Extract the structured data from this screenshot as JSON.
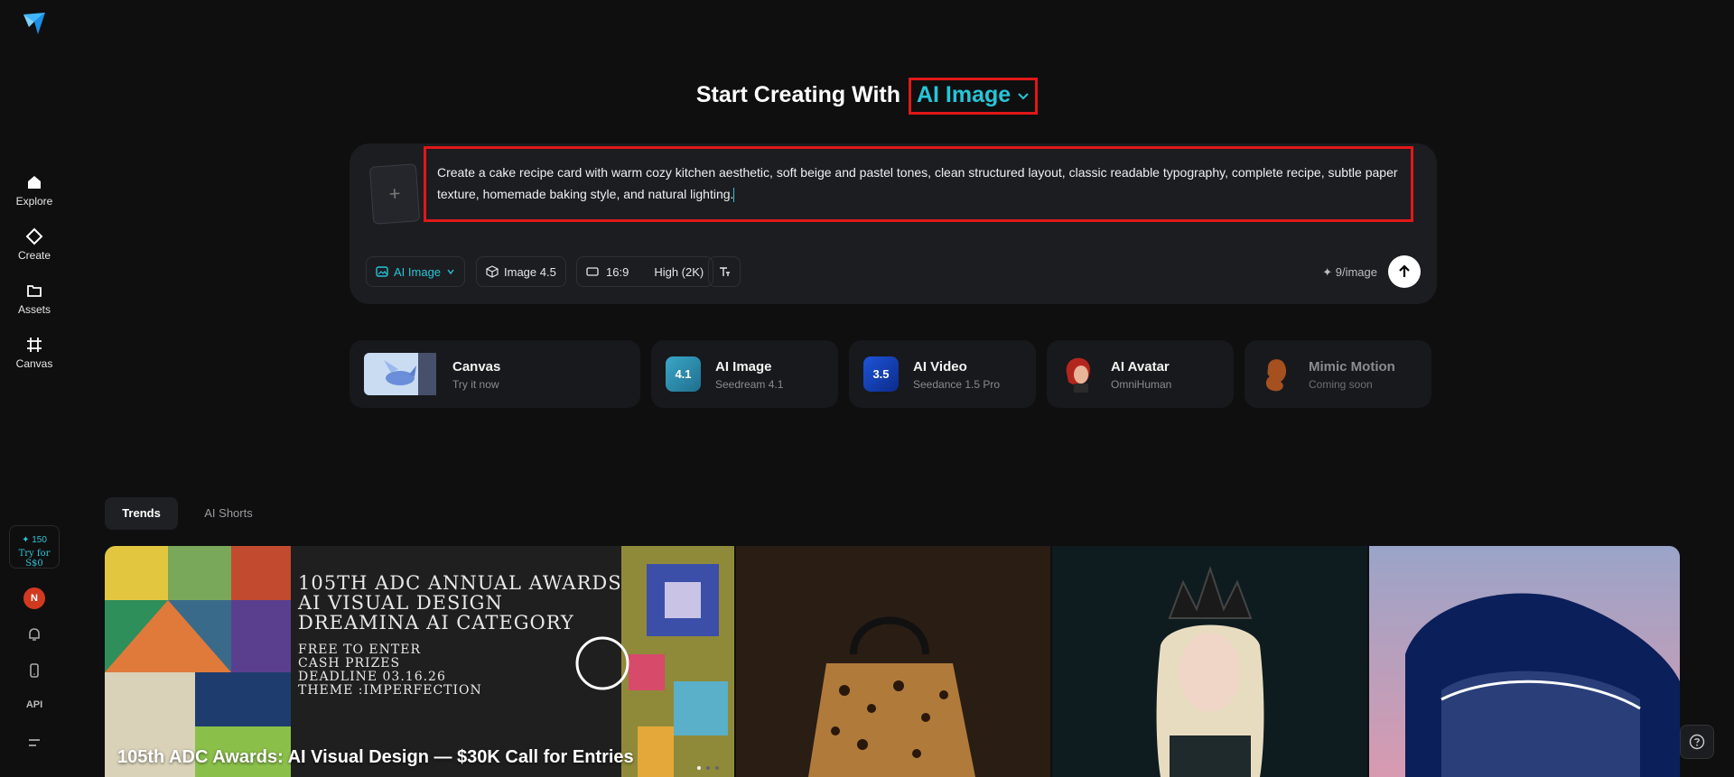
{
  "sidebar": {
    "items": [
      {
        "label": "Explore",
        "icon": "home-icon"
      },
      {
        "label": "Create",
        "icon": "diamond-icon"
      },
      {
        "label": "Assets",
        "icon": "folder-icon"
      },
      {
        "label": "Canvas",
        "icon": "canvas-icon"
      }
    ],
    "credits_amount": "150",
    "credits_promo": "Try for S$0",
    "avatar_initial": "N",
    "api_label": "API"
  },
  "header": {
    "prefix": "Start Creating With",
    "mode": "AI Image"
  },
  "prompt": {
    "text": "Create a cake recipe card with warm cozy kitchen aesthetic, soft beige and pastel tones, clean structured layout, classic readable typography, complete recipe, subtle paper texture, homemade baking style, and natural lighting.",
    "add_symbol": "+"
  },
  "toolbar": {
    "type_label": "AI Image",
    "model_label": "Image 4.5",
    "ratio_label": "16:9",
    "quality_label": "High (2K)",
    "cost_label": "9/image"
  },
  "features": [
    {
      "title": "Canvas",
      "subtitle": "Try it now"
    },
    {
      "title": "AI Image",
      "subtitle": "Seedream 4.1",
      "badge": "4.1"
    },
    {
      "title": "AI Video",
      "subtitle": "Seedance 1.5 Pro",
      "badge": "3.5"
    },
    {
      "title": "AI Avatar",
      "subtitle": "OmniHuman"
    },
    {
      "title": "Mimic Motion",
      "subtitle": "Coming soon"
    }
  ],
  "tabs": [
    {
      "label": "Trends"
    },
    {
      "label": "AI Shorts"
    }
  ],
  "gallery": {
    "featured_title": "105th ADC Awards: AI Visual Design — $30K Call for Entries",
    "poster_lines_big": [
      "105TH ADC ANNUAL AWARDS",
      "AI VISUAL DESIGN",
      "DREAMINA AI CATEGORY"
    ],
    "poster_lines_small": [
      "FREE TO ENTER",
      "CASH PRIZES",
      "DEADLINE 03.16.26",
      "THEME :IMPERFECTION"
    ]
  },
  "colors": {
    "accent": "#27c5d8",
    "highlight_border": "#e01818",
    "background": "#0f0f10",
    "panel": "#1c1d21"
  }
}
